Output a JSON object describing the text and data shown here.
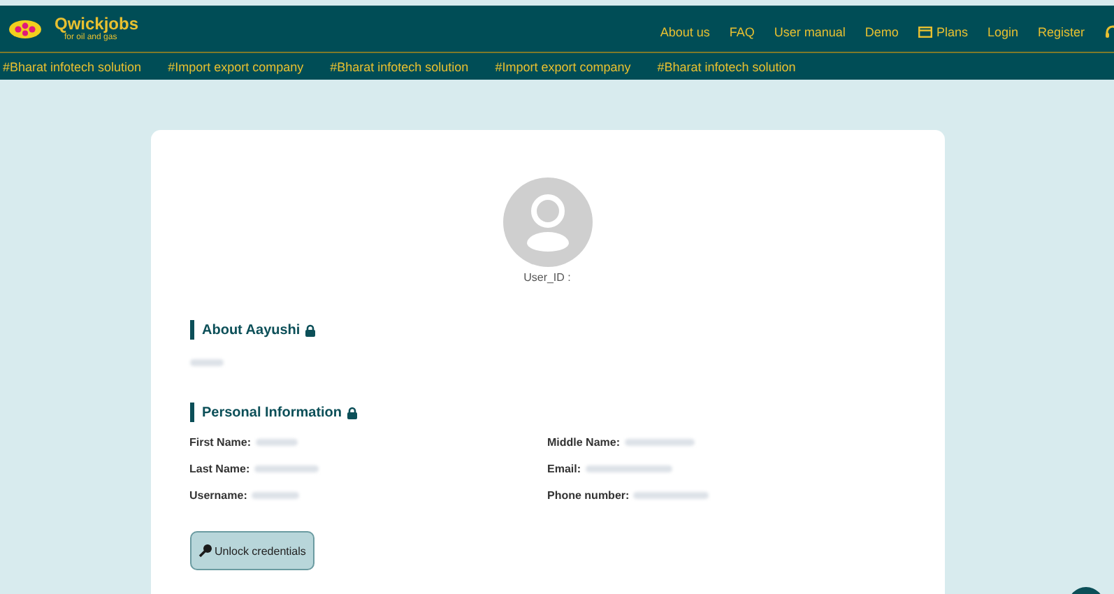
{
  "brand": {
    "name": "Qwickjobs",
    "tagline": "for oil and gas"
  },
  "nav": [
    {
      "label": "About us",
      "kind": "text"
    },
    {
      "label": "FAQ",
      "kind": "text"
    },
    {
      "label": "User manual",
      "kind": "text"
    },
    {
      "label": "Demo",
      "kind": "text"
    },
    {
      "label": "Plans",
      "kind": "plans"
    },
    {
      "label": "Login",
      "kind": "text"
    },
    {
      "label": "Register",
      "kind": "text"
    }
  ],
  "tags": [
    "#Bharat infotech solution",
    "#Import export company",
    "#Bharat infotech solution",
    "#Import export company",
    "#Bharat infotech solution"
  ],
  "profile": {
    "user_id_label": "User_ID :"
  },
  "sections": [
    {
      "title": "About Aayushi",
      "locked": true
    },
    {
      "title": "Personal Information",
      "locked": true
    }
  ],
  "fields_left": [
    {
      "label": "First Name:"
    },
    {
      "label": "Last Name:"
    },
    {
      "label": "Username:"
    }
  ],
  "fields_right": [
    {
      "label": "Middle Name:"
    },
    {
      "label": "Email:"
    },
    {
      "label": "Phone number:"
    }
  ],
  "unlock_button": {
    "label": "Unlock credentials"
  }
}
